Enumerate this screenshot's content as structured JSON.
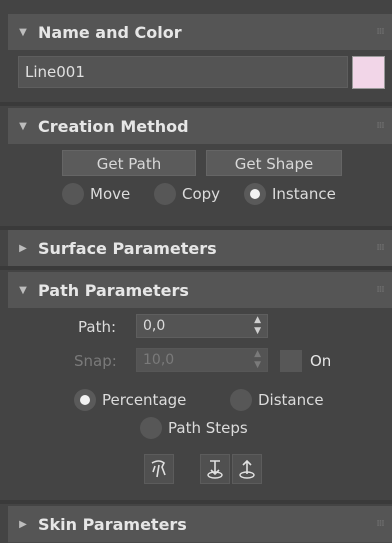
{
  "name_and_color": {
    "title": "Name and Color",
    "name_value": "Line001",
    "swatch_color": "#f2d6e8"
  },
  "creation_method": {
    "title": "Creation Method",
    "get_path": "Get Path",
    "get_shape": "Get Shape",
    "move": "Move",
    "copy": "Copy",
    "instance": "Instance",
    "selected": "Instance"
  },
  "surface_parameters": {
    "title": "Surface Parameters"
  },
  "path_parameters": {
    "title": "Path Parameters",
    "path_label": "Path:",
    "path_value": "0,0",
    "snap_label": "Snap:",
    "snap_value": "10,0",
    "on_label": "On",
    "percentage": "Percentage",
    "distance": "Distance",
    "path_steps": "Path Steps",
    "selected": "Percentage"
  },
  "skin_parameters": {
    "title": "Skin Parameters"
  }
}
